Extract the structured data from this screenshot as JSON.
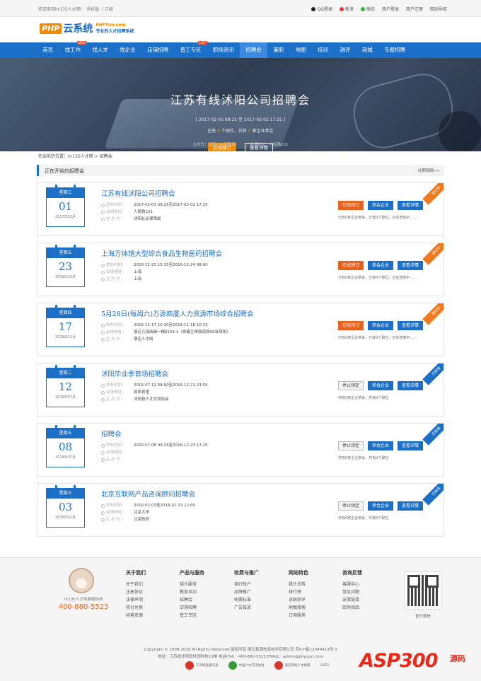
{
  "topbar": {
    "welcome": "欢迎来到hr135人才网!",
    "mobile": "手机版",
    "subscribe": "订阅",
    "qq": "QQ登录",
    "weibo": "新浪",
    "wechat": "微信",
    "login": "用户登录",
    "register": "用户注册",
    "sitenav": "网站导航"
  },
  "logo": {
    "php": "PHP",
    "yun": "云系统",
    "url": "PHPYun.com",
    "slogan": "专业的人才招聘系统"
  },
  "nav": [
    {
      "label": "首页"
    },
    {
      "label": "找工作",
      "tag": "NEW"
    },
    {
      "label": "找人才"
    },
    {
      "label": "找企业"
    },
    {
      "label": "店铺招聘"
    },
    {
      "label": "普工专区",
      "tag": "HOT"
    },
    {
      "label": "职场资讯"
    },
    {
      "label": "招聘会",
      "active": true
    },
    {
      "label": "兼职"
    },
    {
      "label": "地图"
    },
    {
      "label": "培训"
    },
    {
      "label": "测评"
    },
    {
      "label": "商城"
    },
    {
      "label": "专题招聘"
    }
  ],
  "banner": {
    "title": "江苏有线沭阳公司招聘会",
    "date": "[ 2017-02-01 09:25 至 2017-02-02 17:25 ]",
    "count_pre": "已有",
    "jobs": "0",
    "count_mid": "个职位，共有",
    "companies": "0",
    "count_suf": "家企业参会",
    "btn_book": "在线预订",
    "btn_detail": "查看详情",
    "host": "主办方：沭阳社会保障局",
    "venue": "会场地址：人民路101"
  },
  "crumb": "您当前的位置：hr135人才网 > 招聘会",
  "section": {
    "title": "正在开始的招聘会",
    "more": "往期回顾>>"
  },
  "labels": {
    "time": "举办时间：",
    "venue": "会场地址：",
    "host": "主 办 方：",
    "book": "在线预订",
    "stop": "停止预定",
    "join": "参会企业",
    "detail": "查看详情",
    "on": "进行中",
    "end": "已结束"
  },
  "fairs": [
    {
      "week": "星期三",
      "day": "01",
      "ym": "2017年02月",
      "title": "江苏有线沭阳公司招聘会",
      "time": "2017-02-01 09:25至2017-02-02 17:25",
      "venue": "人民路101",
      "host": "沭阳社会保障局",
      "status": "on",
      "stat": "已有0家企业参会，已有0个职位，正在增加中……"
    },
    {
      "week": "星期五",
      "day": "23",
      "ym": "2016年12月",
      "title": "上海万体馆大型综合食品生物医药招聘会",
      "time": "2016-12-23 15:35至2016-12-24 08:00",
      "venue": "上海",
      "host": "上海",
      "status": "on",
      "stat": "已有0家企业参会，已有0个职位，正在增加中……"
    },
    {
      "week": "星期四",
      "day": "17",
      "ym": "2016年11月",
      "title": "5月28日(每周六)万源商厦人力资源市场综合招聘会",
      "time": "2016-11-17 10:30至2016-11-18 10:23",
      "venue": "宿迁万源商城一楼8104-2（原霸王举鼎南侧50米西侧）",
      "host": "宿迁人才网",
      "status": "on",
      "stat": "已有0家企业参会，已有0个职位，正在增加中……"
    },
    {
      "week": "星期二",
      "day": "12",
      "ym": "2016年07月",
      "title": "沭阳毕业季首场招聘会",
      "time": "2016-07-12 08:00至2016-12-21 23:59",
      "venue": "县体育馆",
      "host": "沭阳县人才交流协会",
      "status": "end",
      "stat": "共有0家企业参会，共有0个职位"
    },
    {
      "week": "星期五",
      "day": "08",
      "ym": "2016年07月",
      "title": "招聘会",
      "time": "2016-07-08 09:25至2016-12-23 17:25",
      "venue": "",
      "host": "",
      "status": "end",
      "stat": "共有0家企业参会，共有0个职位"
    },
    {
      "week": "星期三",
      "day": "03",
      "ym": "2016年02月",
      "title": "北京互联网产品咨询顾问招聘会",
      "time": "2016-02-03至2018-01-13 12:00",
      "venue": "北京大学",
      "host": "北京政府",
      "status": "end",
      "stat": "共有0家企业参会，共有0个职位"
    }
  ],
  "footer": {
    "hotline": "hr135人才网客服热线",
    "phone": "400-880-5523",
    "cols": [
      {
        "h": "关于我们",
        "items": [
          "关于我们",
          "注册协议",
          "法律声明",
          "积分兑换",
          "经营资源"
        ]
      },
      {
        "h": "产品与服务",
        "items": [
          "猎头服务",
          "教育培训",
          "招聘会",
          "店铺招聘",
          "普工专区"
        ]
      },
      {
        "h": "收费与推广",
        "items": [
          "银行帐户",
          "品牌推广",
          "收费标准",
          "广告投放"
        ]
      },
      {
        "h": "网站特色",
        "items": [
          "猎头优势",
          "排行榜",
          "求职测评",
          "地图搜索",
          "订阅服务"
        ]
      },
      {
        "h": "咨询反馈",
        "items": [
          "客服中心",
          "常见问题",
          "友情链接",
          "职场指南"
        ]
      }
    ],
    "qr_label": "官方微信",
    "copy1": "Copyright © 2009-2016 All Rights Reserved 版权所有 宿迁鑫潮信息技术有限公司 苏ICP备12049413号-3",
    "copy2": "地址：江苏省沭阳软件园科技10楼 电话(Tel)：400-880-5523 EMAIL：admin@phpyun.com",
    "badges": [
      "工商网监督信息",
      "中国人才交流协会",
      "诚信网站人才联盟",
      "CNZZ"
    ],
    "watermark": "ASP300",
    "watermark2": "源码"
  }
}
